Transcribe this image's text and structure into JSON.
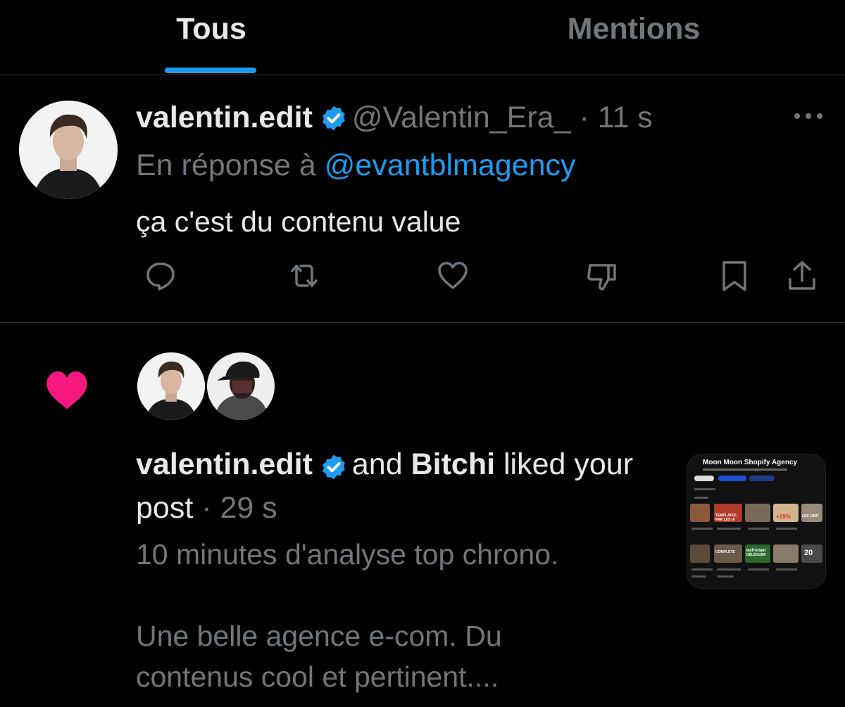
{
  "tabs": {
    "all": "Tous",
    "mentions": "Mentions"
  },
  "reply": {
    "display_name": "valentin.edit",
    "handle": "@Valentin_Era_",
    "time": "· 11 s",
    "in_reply_to_label": "En réponse à",
    "in_reply_to_handle": "@evantblmagency",
    "text": "ça c'est du contenu value"
  },
  "notification": {
    "liker_1": "valentin.edit",
    "connector": "and",
    "liker_2": "Bitchi",
    "action": "liked your post",
    "time": "· 29 s",
    "excerpt": "10 minutes d'analyse top chrono.\n\nUne belle agence e-com. Du\ncontenus cool et pertinent....",
    "thumbnail": {
      "title": "Moon Moon Shopify Agency",
      "labels": [
        "TEMPLATES PAR LES IA",
        "+19%",
        "LES LIMIT",
        "MAÎTRISER DÉLÉGUER",
        "COMPLETE",
        "20"
      ]
    }
  },
  "colors": {
    "accent": "#1d9bf0",
    "like": "#f91880",
    "muted": "#71767b",
    "text": "#e7e9ea"
  },
  "icons": [
    "reply-icon",
    "repost-icon",
    "like-icon",
    "downvote-icon",
    "bookmark-icon",
    "share-icon",
    "more-icon",
    "verified-icon",
    "heart-icon"
  ]
}
